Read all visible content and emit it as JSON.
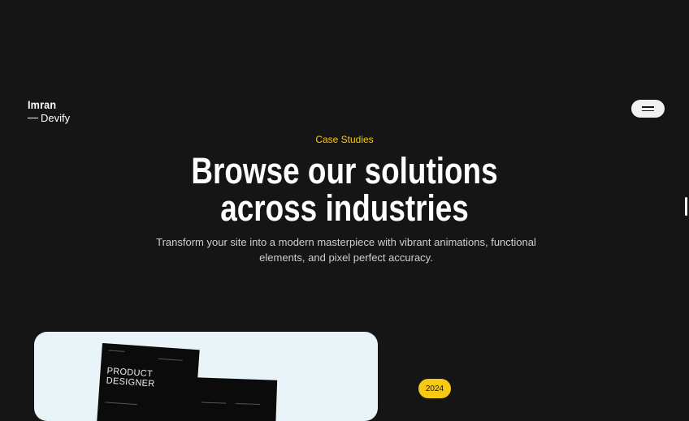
{
  "logo": {
    "line1": "Imran",
    "line2": "Devify"
  },
  "hero": {
    "eyebrow": "Case Studies",
    "headline_line1": "Browse our solutions",
    "headline_line2": "across industries",
    "subtitle": "Transform your site into a modern masterpiece with vibrant animations, functional elements, and pixel perfect accuracy."
  },
  "case_card": {
    "doc_title_line1": "PRODUCT",
    "doc_title_line2": "DESIGNER",
    "year": "2024"
  },
  "icons": {
    "menu": "hamburger-menu-icon"
  },
  "colors": {
    "background": "#161516",
    "accent": "#f6c915",
    "card_bg": "#e8f4f8"
  }
}
